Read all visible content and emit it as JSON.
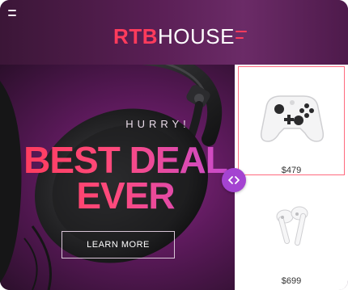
{
  "header": {
    "brand_primary": "RTB",
    "brand_secondary": "HOUSE",
    "menu_icon": "hamburger-icon"
  },
  "hero": {
    "eyebrow": "HURRY!",
    "headline_line1": "BEST DEAL",
    "headline_line2": "EVER",
    "cta_label": "LEARN MORE",
    "image": "headphones-image"
  },
  "products": [
    {
      "image": "game-controller-image",
      "price": "$479"
    },
    {
      "image": "earbuds-image",
      "price": "$699"
    }
  ],
  "slider": {
    "icon": "chevron-left-right-icon"
  },
  "colors": {
    "accent_red": "#ff3b5c",
    "accent_purple": "#a443d1",
    "header_bg": "#5a1f55"
  }
}
